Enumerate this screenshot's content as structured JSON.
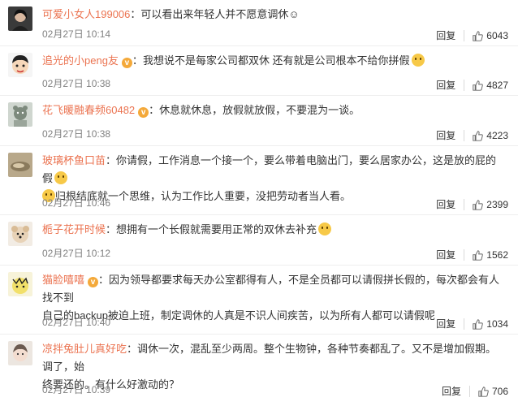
{
  "comments": [
    {
      "user": "可爱小女人199006",
      "verified": false,
      "text": "可以看出来年轻人并不愿意调休☺",
      "time": "02月27日 10:14",
      "reply": "回复",
      "likes": "6043"
    },
    {
      "user": "追光的小peng友",
      "verified": true,
      "text": "我想说不是每家公司都双休 还有就是公司根本不给你拼假",
      "time": "02月27日 10:38",
      "reply": "回复",
      "likes": "4827"
    },
    {
      "user": "花飞暖融春频60482",
      "verified": true,
      "text": "休息就休息，放假就放假，不要混为一谈。",
      "time": "02月27日 10:38",
      "reply": "回复",
      "likes": "4223"
    },
    {
      "user": "玻璃杯鱼口苗",
      "verified": false,
      "text": "你请假，工作消息一个接一个，要么带着电脑出门，要么居家办公，这是放的屁的假",
      "text2": "归根结底就一个思维，认为工作比人重要，没把劳动者当人看。",
      "time": "02月27日 10:46",
      "reply": "回复",
      "likes": "2399"
    },
    {
      "user": "栀子花开时候",
      "verified": false,
      "text": "想拥有一个长假就需要用正常的双休去补充",
      "time": "02月27日 10:12",
      "reply": "回复",
      "likes": "1562"
    },
    {
      "user": "猫脸嘻嘻",
      "verified": true,
      "text": "因为领导都要求每天办公室都得有人，不是全员都可以请假拼长假的，每次都会有人找不到",
      "text2": "自己的backup被迫上班，制定调休的人真是不识人间疾苦，以为所有人都可以请假呢",
      "time": "02月27日 10:40",
      "reply": "回复",
      "likes": "1034"
    },
    {
      "user": "凉拌兔肚儿真好吃",
      "verified": false,
      "text": "调休一次，混乱至少两周。整个生物钟，各种节奏都乱了。又不是增加假期。调了，始",
      "text2": "终要还的。有什么好激动的？",
      "time": "02月27日 10:39",
      "reply": "回复",
      "likes": "706"
    }
  ],
  "colors": {
    "username": "#eb7350",
    "meta": "#808080",
    "verified": "#f4a93a"
  },
  "icons": {
    "like": "thumbs-up-icon",
    "verified": "verified-badge-icon"
  }
}
